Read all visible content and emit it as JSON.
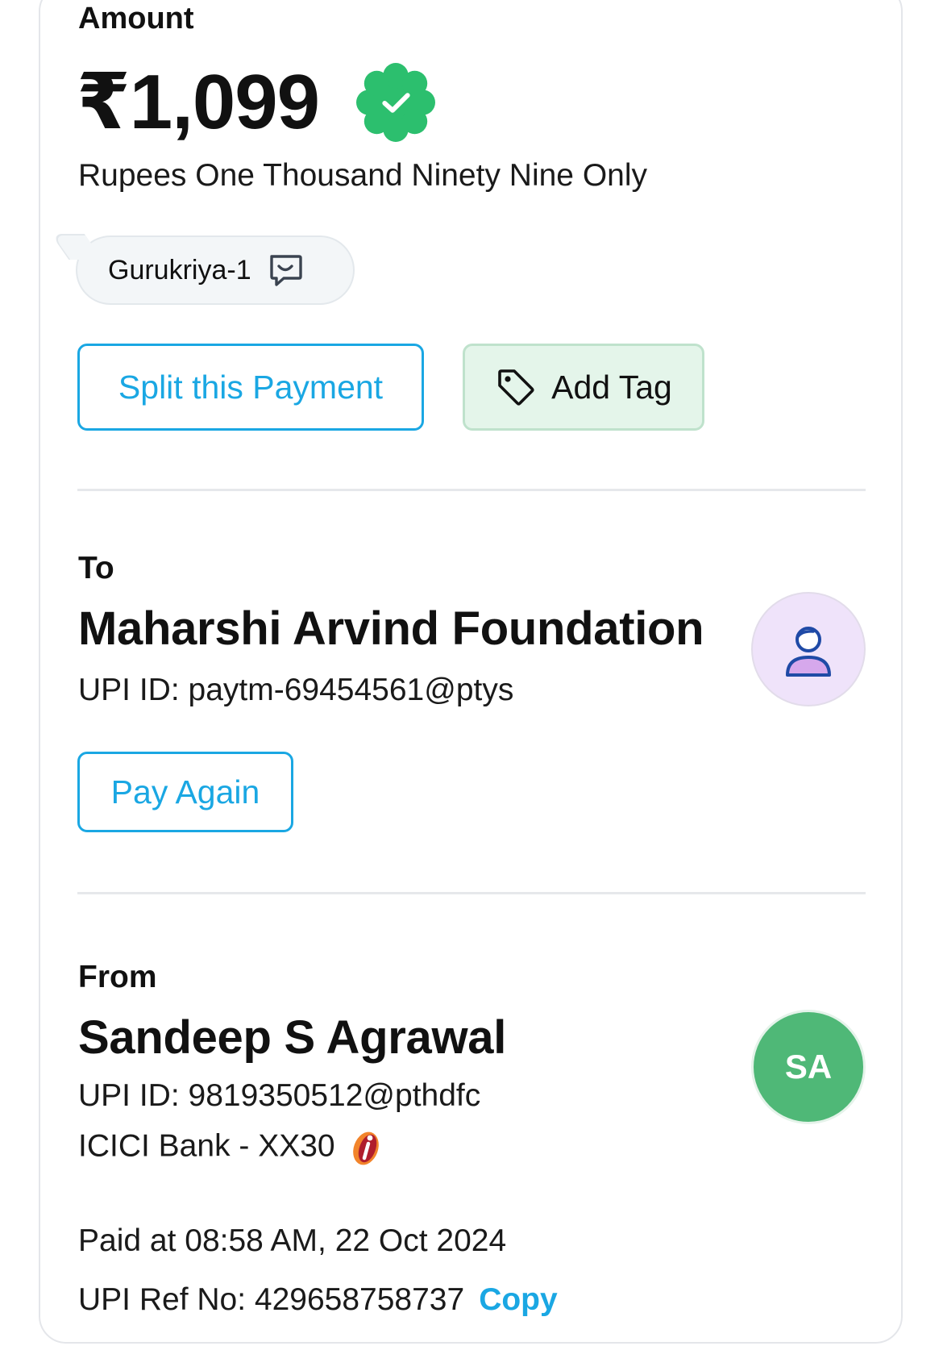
{
  "amount": {
    "label": "Amount",
    "value": "₹1,099",
    "in_words": "Rupees One Thousand Ninety Nine Only",
    "status_icon": "verified-check-icon",
    "status_color": "#2cbf6e"
  },
  "note": {
    "text": "Gurukriya-1",
    "icon": "chat-message-icon"
  },
  "actions": {
    "split_label": "Split this Payment",
    "tag_label": "Add Tag",
    "tag_icon": "tag-icon"
  },
  "to": {
    "label": "To",
    "name": "Maharshi Arvind Foundation",
    "upi_id": "UPI ID: paytm-69454561@ptys",
    "pay_again_label": "Pay Again",
    "avatar_icon": "person-icon"
  },
  "from": {
    "label": "From",
    "name": "Sandeep S Agrawal",
    "upi_id": "UPI ID: 9819350512@pthdfc",
    "bank": "ICICI Bank - XX30",
    "bank_icon": "icici-logo-icon",
    "avatar_initials": "SA"
  },
  "meta": {
    "paid_at": "Paid at 08:58 AM, 22 Oct 2024",
    "ref_no": "UPI Ref No: 429658758737",
    "copy_label": "Copy"
  },
  "colors": {
    "accent": "#1aa7e3",
    "success": "#2cbf6e",
    "tag_bg": "#e4f5ea",
    "avatar_to_bg": "#efe3fa",
    "avatar_from_bg": "#4fb877"
  }
}
